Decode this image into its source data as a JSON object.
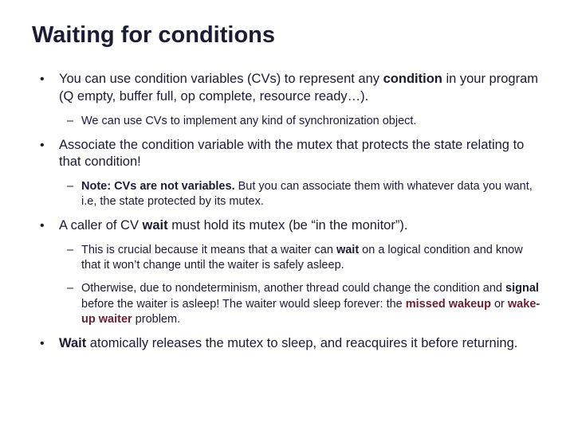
{
  "title": "Waiting for conditions",
  "b1": {
    "pre": "You can use condition variables (CVs) to represent any ",
    "bold": "condition",
    "post": " in your program (Q empty, buffer full, op complete, resource ready…).",
    "sub1": "We can use CVs to implement any kind of synchronization object."
  },
  "b2": {
    "text": "Associate the condition variable with the mutex that protects the state relating to that condition!",
    "sub1": {
      "bold": "Note: CVs are not variables.",
      "rest": " But you can associate them with whatever data you want, i.e, the state protected by its mutex."
    }
  },
  "b3": {
    "pre": "A caller of CV ",
    "bold": "wait",
    "post": " must hold its mutex (be “in the monitor”).",
    "sub1": {
      "pre": "This is crucial because it means that a waiter can ",
      "bold": "wait",
      "post": " on a logical condition and know that it won’t change until the waiter is safely asleep."
    },
    "sub2": {
      "pre": "Otherwise, due to nondeterminism, another thread could change the condition and ",
      "bold": "signal",
      "mid": " before the waiter is asleep!   The waiter would sleep forever: the ",
      "m1": "missed wakeup",
      "or": " or ",
      "m2": "wake-up waiter",
      "end": " problem."
    }
  },
  "b4": {
    "bold": "Wait",
    "rest": " atomically releases the mutex to sleep, and reacquires it before returning."
  }
}
